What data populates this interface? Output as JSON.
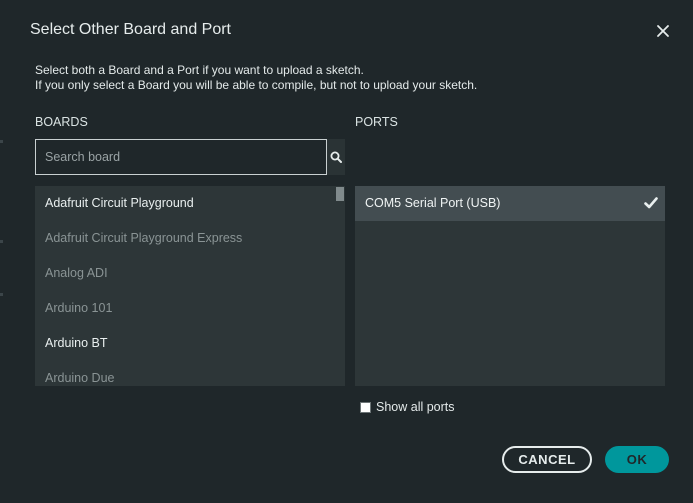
{
  "dialog": {
    "title": "Select Other Board and Port",
    "description_line1": "Select both a Board and a Port if you want to upload a sketch.",
    "description_line2": "If you only select a Board you will be able to compile, but not to upload your sketch."
  },
  "boards": {
    "label": "BOARDS",
    "search_placeholder": "Search board",
    "search_value": "",
    "items": [
      {
        "label": "Adafruit Circuit Playground",
        "emphasis": "bright"
      },
      {
        "label": "Adafruit Circuit Playground Express",
        "emphasis": "dim"
      },
      {
        "label": "Analog ADI",
        "emphasis": "dim"
      },
      {
        "label": "Arduino 101",
        "emphasis": "dim"
      },
      {
        "label": "Arduino BT",
        "emphasis": "bright"
      },
      {
        "label": "Arduino Due",
        "emphasis": "dim"
      }
    ]
  },
  "ports": {
    "label": "PORTS",
    "items": [
      {
        "label": "COM5 Serial Port (USB)",
        "selected": true
      }
    ],
    "show_all_label": "Show all ports",
    "show_all_checked": false
  },
  "buttons": {
    "cancel": "CANCEL",
    "ok": "OK"
  },
  "colors": {
    "background": "#1f272a",
    "panel": "#2d3638",
    "selected_row": "#434d51",
    "accent": "#00979c"
  }
}
